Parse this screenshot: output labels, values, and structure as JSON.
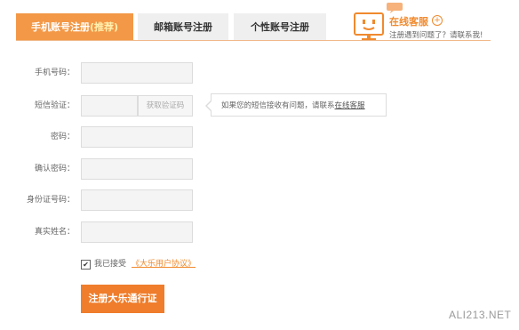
{
  "tabs": [
    {
      "label": "手机账号注册",
      "badge": "(推荐)",
      "active": true
    },
    {
      "label": "邮箱账号注册",
      "active": false
    },
    {
      "label": "个性账号注册",
      "active": false
    }
  ],
  "service": {
    "title": "在线客服",
    "plus": "+",
    "subtitle": "注册遇到问题了？请联系我!"
  },
  "form": {
    "phone_label": "手机号码：",
    "sms_label": "短信验证：",
    "get_code_button": "获取验证码",
    "sms_tip": "如果您的短信接收有问题，请联系",
    "sms_tip_link": "在线客服",
    "password_label": "密码：",
    "confirm_password_label": "确认密码：",
    "id_label": "身份证号码：",
    "name_label": "真实姓名："
  },
  "agreement": {
    "checked": true,
    "check_mark": "✔",
    "prefix": "我已接受",
    "link": "《大乐用户协议》"
  },
  "submit_label": "注册大乐通行证",
  "watermark": "ALI213.NET",
  "colors": {
    "accent": "#f39846",
    "button": "#ef7d2b",
    "link": "#f08a2e"
  }
}
